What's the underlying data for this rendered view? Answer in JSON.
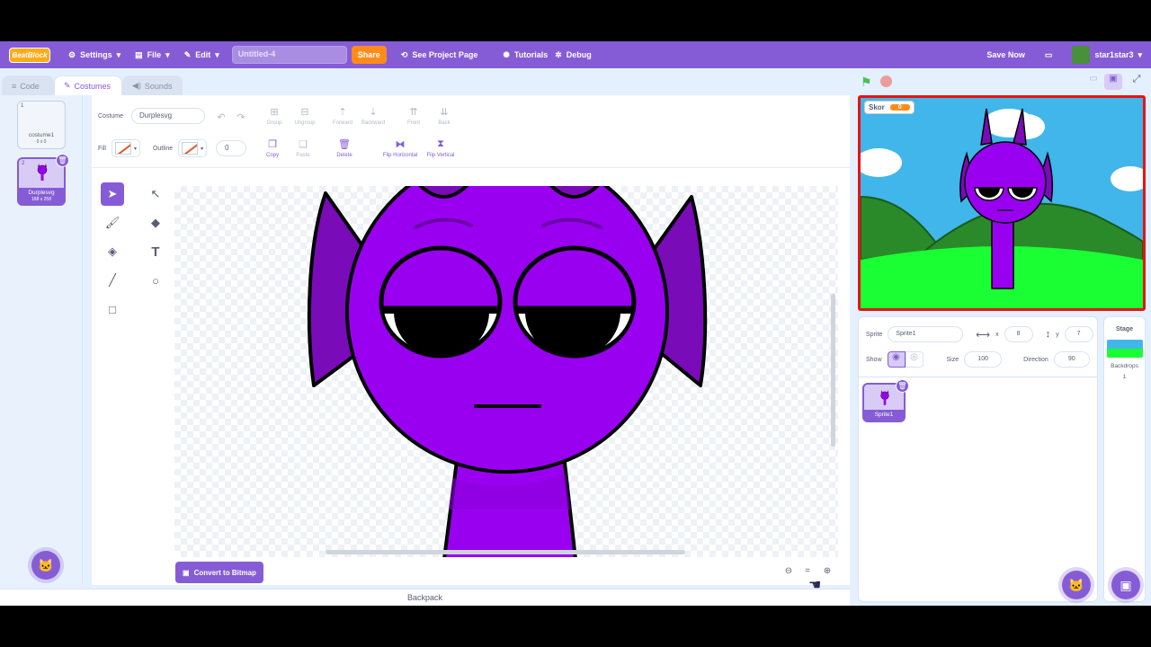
{
  "menubar": {
    "logo_text": "BeatBlock",
    "settings": "Settings",
    "file": "File",
    "edit": "Edit",
    "project_title": "Untitled-4",
    "share": "Share",
    "see_project_page": "See Project Page",
    "tutorials": "Tutorials",
    "debug": "Debug",
    "save_now": "Save Now",
    "username": "star1star3"
  },
  "tabs": {
    "code": "Code",
    "costumes": "Costumes",
    "sounds": "Sounds"
  },
  "costumes": [
    {
      "num": "1",
      "name": "costume1",
      "size": "0 x 0"
    },
    {
      "num": "2",
      "name": "Durplesvg",
      "size": "188 x 258"
    }
  ],
  "editor": {
    "costume_label": "Costume",
    "costume_name": "Durplesvg",
    "group": "Group",
    "ungroup": "Ungroup",
    "forward": "Forward",
    "backward": "Backward",
    "front": "Front",
    "back": "Back",
    "fill_label": "Fill",
    "outline_label": "Outline",
    "outline_width": "0",
    "copy": "Copy",
    "paste": "Paste",
    "delete": "Delete",
    "flip_h": "Flip Horizontal",
    "flip_v": "Flip Vertical",
    "convert": "Convert to Bitmap"
  },
  "backpack": "Backpack",
  "stage": {
    "score_label": "Skor",
    "score_value": "0"
  },
  "sprite": {
    "sprite_label": "Sprite",
    "sprite_name": "Sprite1",
    "x_label": "x",
    "x": "8",
    "y_label": "y",
    "y": "7",
    "show_label": "Show",
    "size_label": "Size",
    "size": "100",
    "direction_label": "Direction",
    "direction": "90",
    "tile_name": "Sprite1"
  },
  "stagepane": {
    "title": "Stage",
    "backdrops_label": "Backdrops",
    "backdrops_count": "1"
  },
  "colors": {
    "accent": "#855cd6",
    "share": "#ff8c1a",
    "character": "#9a00f0",
    "stage_border": "#e51414"
  }
}
